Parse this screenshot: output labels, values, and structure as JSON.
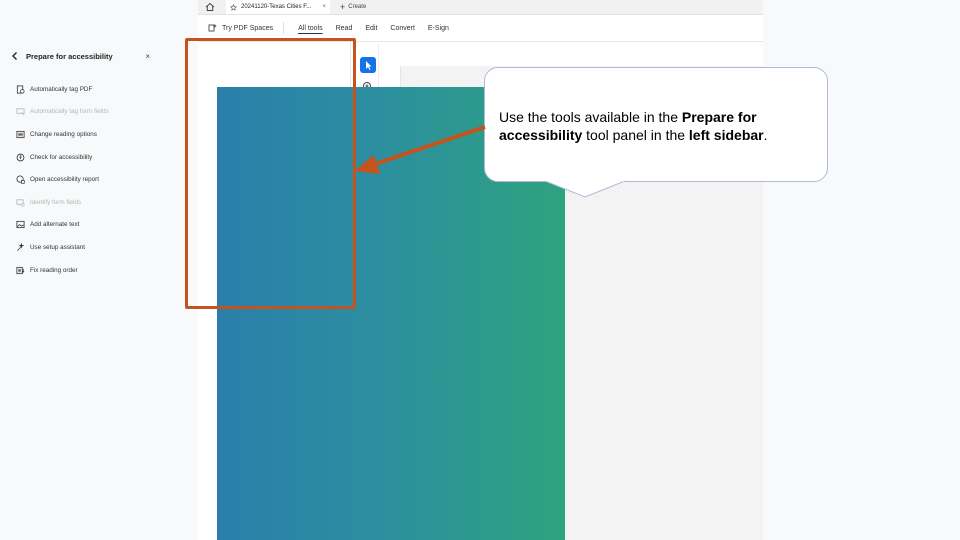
{
  "browser": {
    "tab_title": "20241120-Texas Cities F...",
    "tab_close": "×",
    "new_tab_label": "Create",
    "new_tab_plus": "+"
  },
  "toolbar": {
    "spaces_label": "Try PDF Spaces",
    "nav": [
      "All tools",
      "Read",
      "Edit",
      "Convert",
      "E-Sign"
    ]
  },
  "panel": {
    "title": "Prepare for accessibility",
    "close": "×",
    "tools": [
      {
        "label": "Automatically tag PDF",
        "icon": "auto-tag-icon",
        "enabled": true
      },
      {
        "label": "Automatically tag form fields",
        "icon": "tag-form-fields-icon",
        "enabled": false
      },
      {
        "label": "Change reading options",
        "icon": "reading-options-icon",
        "enabled": true
      },
      {
        "label": "Check for accessibility",
        "icon": "accessibility-check-icon",
        "enabled": true
      },
      {
        "label": "Open accessibility report",
        "icon": "accessibility-report-icon",
        "enabled": true
      },
      {
        "label": "Identify form fields",
        "icon": "identify-form-fields-icon",
        "enabled": false
      },
      {
        "label": "Add alternate text",
        "icon": "alt-text-icon",
        "enabled": true
      },
      {
        "label": "Use setup assistant",
        "icon": "setup-assistant-icon",
        "enabled": true
      },
      {
        "label": "Fix reading order",
        "icon": "reading-order-icon",
        "enabled": true
      }
    ]
  },
  "callout": {
    "text_1": "Use the tools available in the ",
    "bold_1": "Prepare for accessibility",
    "text_2": " tool panel in the ",
    "bold_2": "left sidebar",
    "text_3": "."
  },
  "colors": {
    "highlight": "#c5531e",
    "accent": "#1473e6",
    "callout_border": "#aebbd5"
  }
}
